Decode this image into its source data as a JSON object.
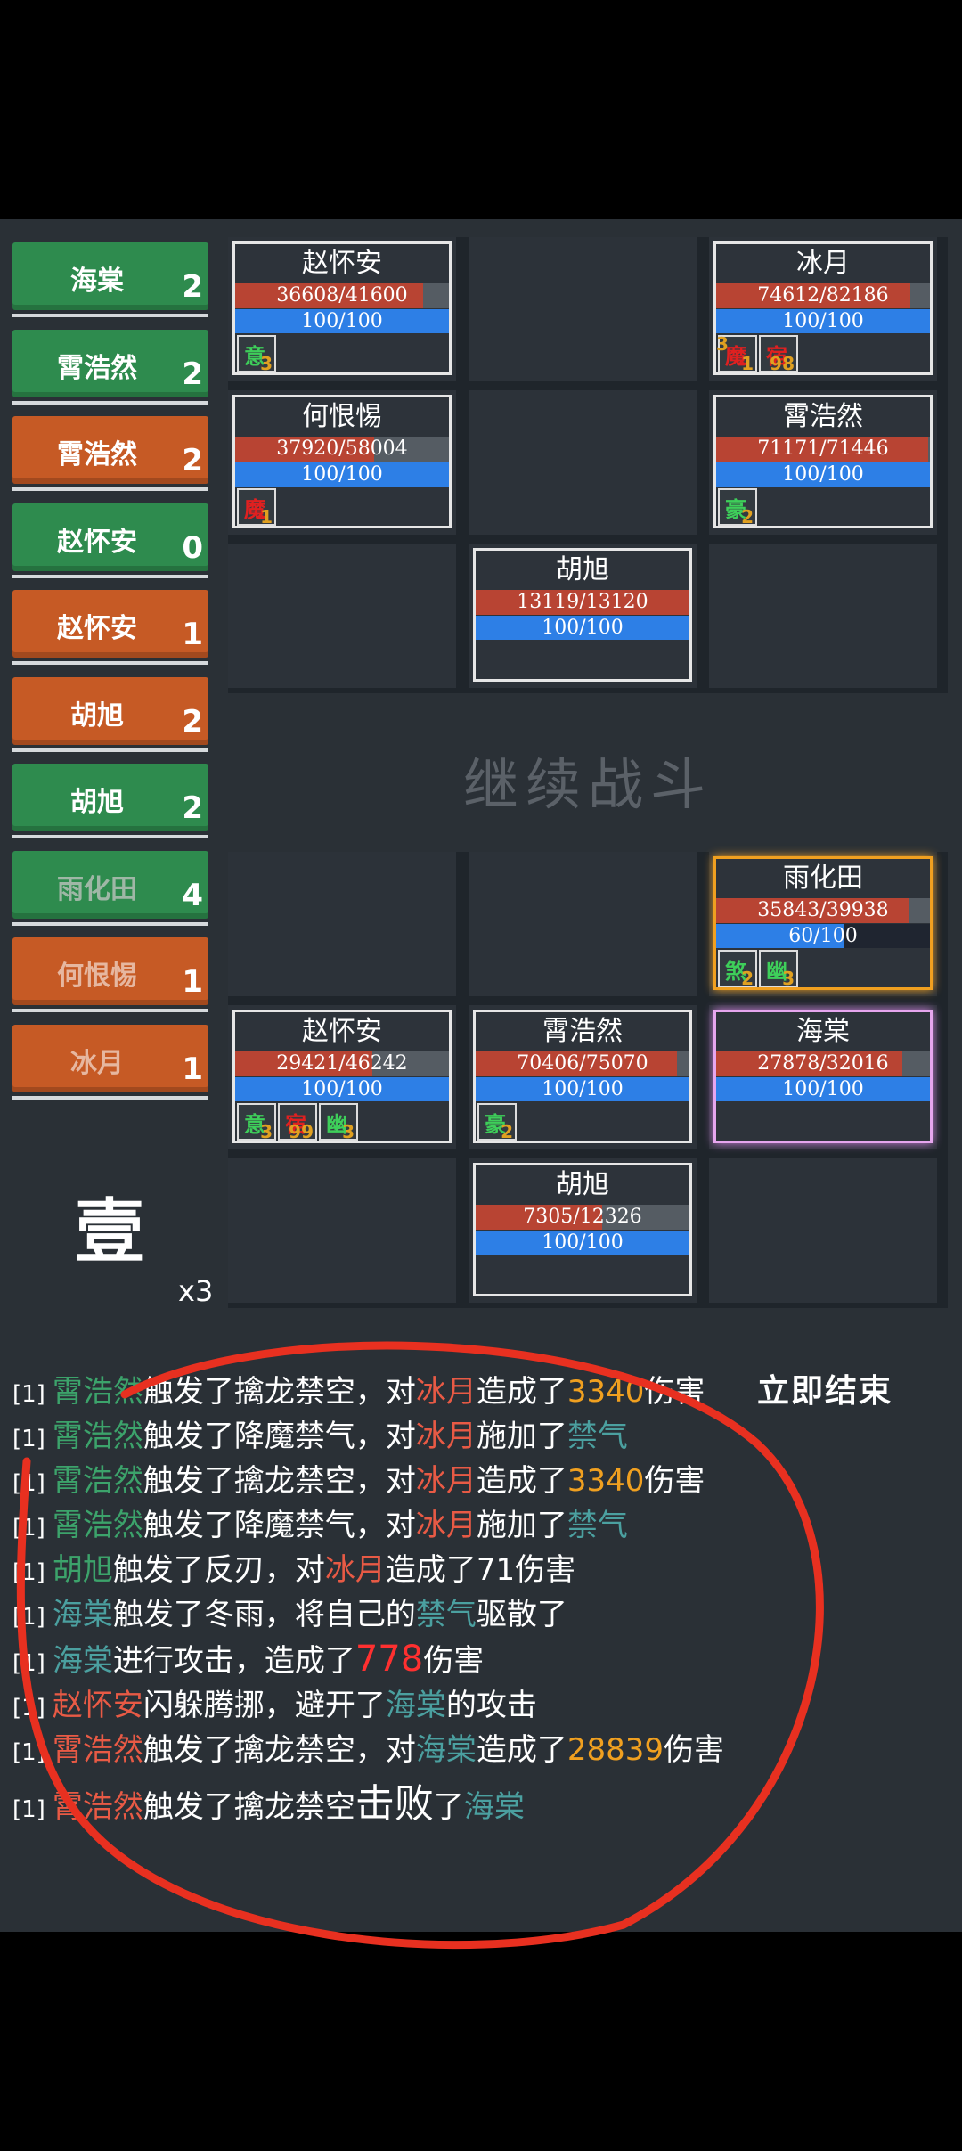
{
  "turn_order": [
    {
      "name": "海棠",
      "count": "2",
      "side": "green"
    },
    {
      "name": "霄浩然",
      "count": "2",
      "side": "green"
    },
    {
      "name": "霄浩然",
      "count": "2",
      "side": "orange"
    },
    {
      "name": "赵怀安",
      "count": "0",
      "side": "green"
    },
    {
      "name": "赵怀安",
      "count": "1",
      "side": "orange"
    },
    {
      "name": "胡旭",
      "count": "2",
      "side": "orange"
    },
    {
      "name": "胡旭",
      "count": "2",
      "side": "green"
    },
    {
      "name": "雨化田",
      "count": "4",
      "side": "green"
    },
    {
      "name": "何恨惕",
      "count": "1",
      "side": "orange"
    },
    {
      "name": "冰月",
      "count": "1",
      "side": "orange"
    }
  ],
  "enemy_units": [
    {
      "name": "赵怀安",
      "hp": "36608/41600",
      "hp_frac": 0.88,
      "mp": "100/100",
      "mp_frac": 1,
      "buffs": [
        {
          "glyph": "意",
          "color": "#3ecf5a",
          "num": "3"
        }
      ]
    },
    {
      "name": "冰月",
      "hp": "74612/82186",
      "hp_frac": 0.91,
      "mp": "100/100",
      "mp_frac": 1,
      "buffs": [
        {
          "glyph": "魔",
          "color": "#e02020",
          "num": "1",
          "pre": "3"
        },
        {
          "glyph": "宿",
          "color": "#e02020",
          "num": "98"
        }
      ]
    },
    {
      "name": "何恨惕",
      "hp": "37920/58004",
      "hp_frac": 0.65,
      "mp": "100/100",
      "mp_frac": 1,
      "buffs": [
        {
          "glyph": "魔",
          "color": "#e02020",
          "num": "1"
        }
      ]
    },
    {
      "name": "霄浩然",
      "hp": "71171/71446",
      "hp_frac": 0.99,
      "mp": "100/100",
      "mp_frac": 1,
      "buffs": [
        {
          "glyph": "豪",
          "color": "#3ecf5a",
          "num": "2"
        }
      ]
    },
    {
      "name": "胡旭",
      "hp": "13119/13120",
      "hp_frac": 1,
      "mp": "100/100",
      "mp_frac": 1,
      "buffs": []
    }
  ],
  "ally_units": [
    {
      "name": "雨化田",
      "hp": "35843/39938",
      "hp_frac": 0.9,
      "mp": "60/100",
      "mp_frac": 0.6,
      "buffs": [
        {
          "glyph": "煞",
          "color": "#3ecf5a",
          "num": "2"
        },
        {
          "glyph": "幽",
          "color": "#3ecf5a",
          "num": "3"
        }
      ]
    },
    {
      "name": "赵怀安",
      "hp": "29421/46242",
      "hp_frac": 0.64,
      "mp": "100/100",
      "mp_frac": 1,
      "buffs": [
        {
          "glyph": "意",
          "color": "#3ecf5a",
          "num": "3"
        },
        {
          "glyph": "宿",
          "color": "#e02020",
          "num": "99"
        },
        {
          "glyph": "幽",
          "color": "#3ecf5a",
          "num": "3"
        }
      ]
    },
    {
      "name": "霄浩然",
      "hp": "70406/75070",
      "hp_frac": 0.94,
      "mp": "100/100",
      "mp_frac": 1,
      "buffs": [
        {
          "glyph": "豪",
          "color": "#3ecf5a",
          "num": "2"
        }
      ]
    },
    {
      "name": "海棠",
      "hp": "27878/32016",
      "hp_frac": 0.87,
      "mp": "100/100",
      "mp_frac": 1,
      "buffs": []
    },
    {
      "name": "胡旭",
      "hp": "7305/12326",
      "hp_frac": 0.59,
      "mp": "100/100",
      "mp_frac": 1,
      "buffs": []
    }
  ],
  "continue_label": "继续战斗",
  "round_label": "壹",
  "speed_label": "x3",
  "end_label": "立即结束",
  "log_tag": "[1]",
  "log": {
    "l1": {
      "a": "霄浩然",
      "b": "触发了擒龙禁空，对",
      "c": "冰月",
      "d": "造成了",
      "e": "3340",
      "f": "伤害"
    },
    "l2": {
      "a": "霄浩然",
      "b": "触发了降魔禁气，对",
      "c": "冰月",
      "d": "施加了",
      "e": "禁气"
    },
    "l3": {
      "a": "霄浩然",
      "b": "触发了擒龙禁空，对",
      "c": "冰月",
      "d": "造成了",
      "e": "3340",
      "f": "伤害"
    },
    "l4": {
      "a": "霄浩然",
      "b": "触发了降魔禁气，对",
      "c": "冰月",
      "d": "施加了",
      "e": "禁气"
    },
    "l5": {
      "a": "胡旭",
      "b": "触发了反刃，对",
      "c": "冰月",
      "d": "造成了71伤害"
    },
    "l6": {
      "a": "海棠",
      "b": "触发了冬雨，将自己的",
      "c": "禁气",
      "d": "驱散了"
    },
    "l7": {
      "a": "海棠",
      "b": "进行攻击，造成了",
      "c": "778",
      "d": "伤害"
    },
    "l8": {
      "a": "赵怀安",
      "b": "闪躲腾挪，避开了",
      "c": "海棠",
      "d": "的攻击"
    },
    "l9": {
      "a": "霄浩然",
      "b": "触发了擒龙禁空，对",
      "c": "海棠",
      "d": "造成了",
      "e": "28839",
      "f": "伤害"
    },
    "l10": {
      "a": "霄浩然",
      "b": "触发了擒龙禁空",
      "c": "击败",
      "d": "了",
      "e": "海棠"
    }
  }
}
